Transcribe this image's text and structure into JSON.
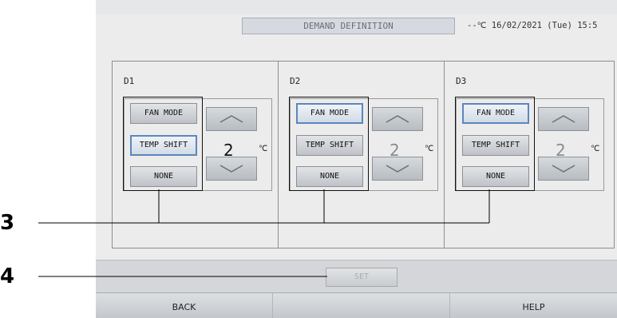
{
  "header": {
    "title": "DEMAND DEFINITION",
    "clock": "--℃  16/02/2021 (Tue) 15:5"
  },
  "panels": [
    {
      "label": "D1",
      "modes": [
        "FAN MODE",
        "TEMP SHIFT",
        "NONE"
      ],
      "active": "TEMP SHIFT",
      "temp": "2",
      "unit": "℃"
    },
    {
      "label": "D2",
      "modes": [
        "FAN MODE",
        "TEMP SHIFT",
        "NONE"
      ],
      "active": "FAN MODE",
      "temp": "2",
      "unit": "℃"
    },
    {
      "label": "D3",
      "modes": [
        "FAN MODE",
        "TEMP SHIFT",
        "NONE"
      ],
      "active": "FAN MODE",
      "temp": "2",
      "unit": "℃"
    }
  ],
  "set_label": "SET",
  "footer": {
    "back": "BACK",
    "help": "HELP"
  },
  "callouts": [
    "3",
    "4"
  ]
}
